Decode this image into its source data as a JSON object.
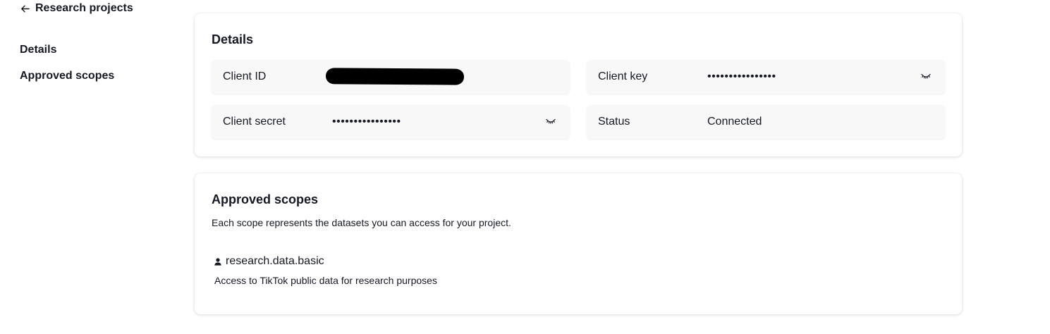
{
  "back": {
    "label": "Research projects",
    "icon": "arrow-left-icon"
  },
  "sidebar": {
    "items": [
      {
        "label": "Details"
      },
      {
        "label": "Approved scopes"
      }
    ]
  },
  "details": {
    "title": "Details",
    "fields": {
      "client_id": {
        "label": "Client ID",
        "value": ""
      },
      "client_key": {
        "label": "Client key",
        "value": "••••••••••••••••",
        "icon": "eye-closed-icon"
      },
      "client_secret": {
        "label": "Client secret",
        "value": "••••••••••••••••",
        "icon": "eye-closed-icon"
      },
      "status": {
        "label": "Status",
        "value": "Connected"
      }
    }
  },
  "scopes": {
    "title": "Approved scopes",
    "description": "Each scope represents the datasets you can access for your project.",
    "items": [
      {
        "name": "research.data.basic",
        "description": "Access to TikTok public data for research purposes",
        "icon": "user-icon"
      }
    ]
  }
}
